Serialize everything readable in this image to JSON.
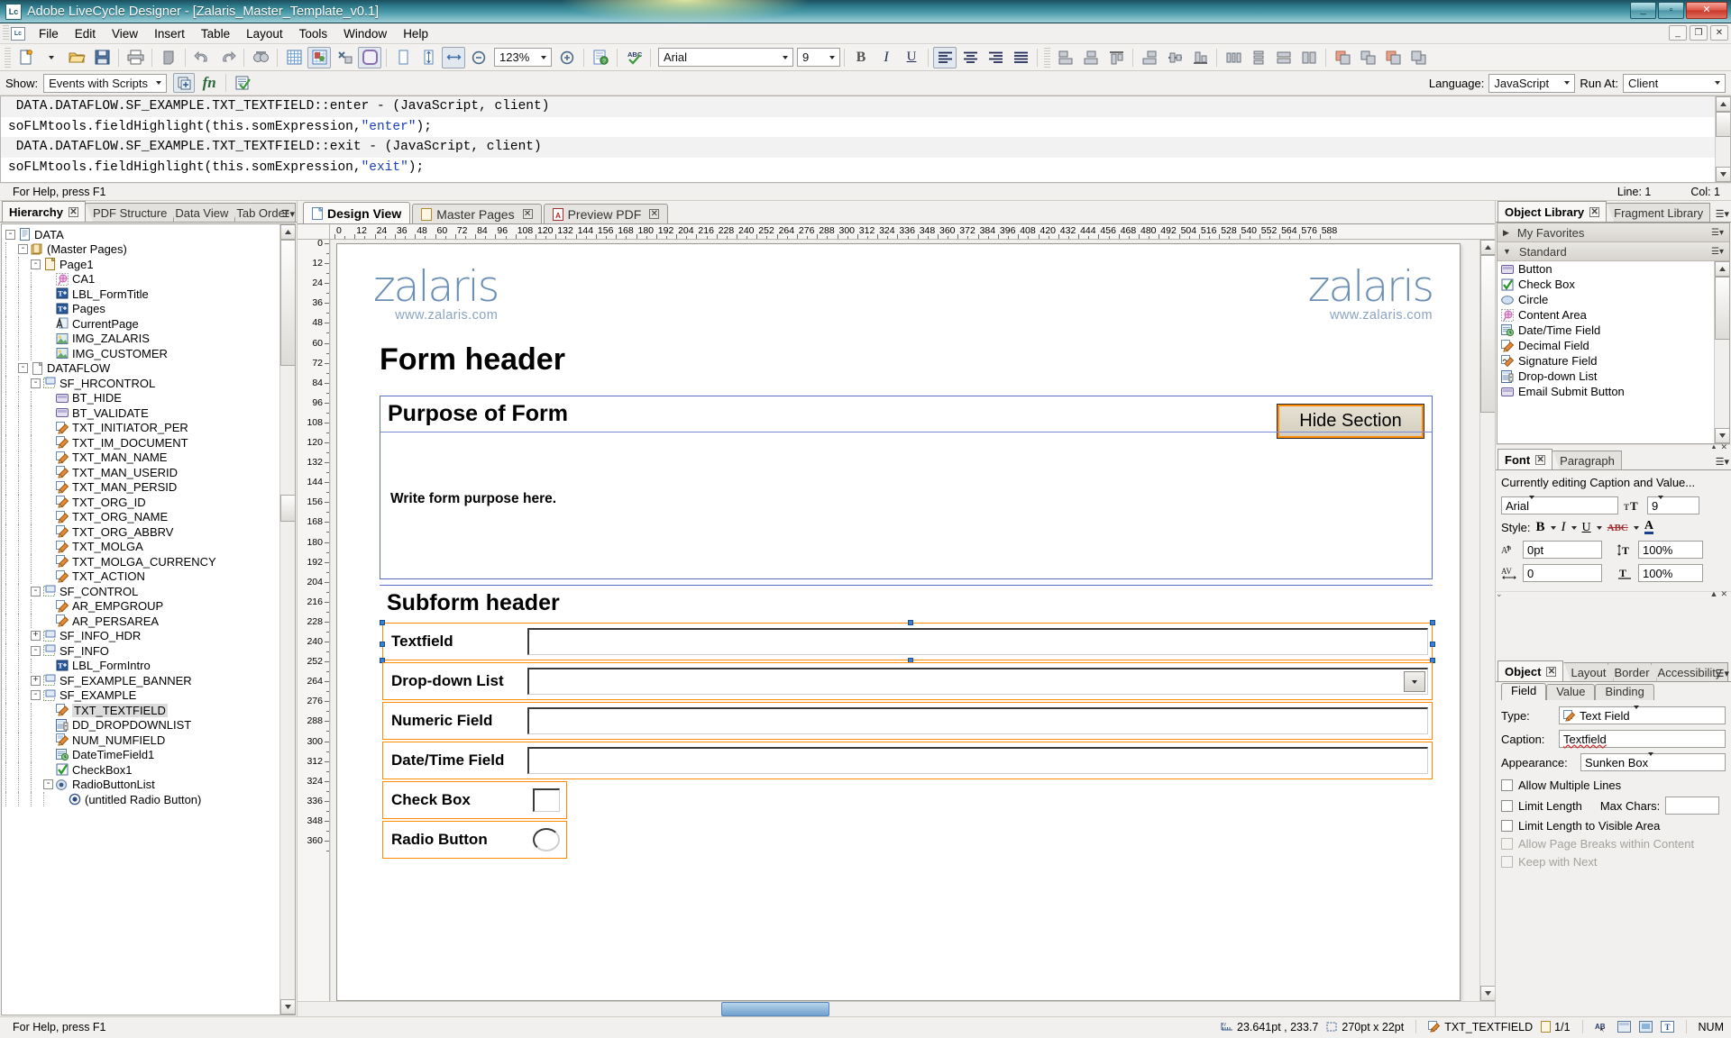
{
  "window": {
    "title": "Adobe LiveCycle Designer - [Zalaris_Master_Template_v0.1]",
    "app_icon": "Lc",
    "minimize": "_",
    "maximize": "▫",
    "close": "✕",
    "doc_minimize": "_",
    "doc_restore": "❐",
    "doc_close": "✕"
  },
  "menubar": {
    "items": [
      "File",
      "Edit",
      "View",
      "Insert",
      "Table",
      "Layout",
      "Tools",
      "Window",
      "Help"
    ]
  },
  "toolbar": {
    "zoom_value": "123%",
    "font_name": "Arial",
    "font_size": "9",
    "icons": [
      "new-document-icon",
      "open-folder-icon",
      "save-icon",
      "print-icon",
      "print-preview-icon",
      "undo-icon",
      "redo-icon",
      "find-icon",
      "grid-icon",
      "snap-to-grid-icon",
      "tab-order-icon",
      "content-area-icon",
      "page-width-icon",
      "page-height-icon",
      "fit-page-icon",
      "zoom-out-icon",
      "zoom-in-icon",
      "form-properties-icon",
      "spell-check-icon",
      "bold-icon",
      "italic-icon",
      "underline-icon",
      "align-left-icon",
      "align-center-icon",
      "align-right-icon",
      "align-justify-icon",
      "align-obj-left-icon",
      "align-obj-center-icon",
      "align-obj-right-icon",
      "align-obj-top-icon",
      "align-obj-middle-icon",
      "align-obj-bottom-icon",
      "distribute-h-icon",
      "distribute-v-icon",
      "same-width-icon",
      "same-height-icon",
      "group-icon",
      "ungroup-icon",
      "bring-front-icon",
      "send-back-icon"
    ]
  },
  "script_editor": {
    "show_label": "Show:",
    "show_value": "Events with Scripts",
    "language_label": "Language:",
    "language_value": "JavaScript",
    "runat_label": "Run At:",
    "runat_value": "Client",
    "lines": [
      {
        "type": "header",
        "text": " DATA.DATAFLOW.SF_EXAMPLE.TXT_TEXTFIELD::enter - (JavaScript, client)"
      },
      {
        "type": "code",
        "text": "soFLMtools.fieldHighlight(this.somExpression,",
        "str": "\"enter\"",
        "tail": ");"
      },
      {
        "type": "header",
        "text": " DATA.DATAFLOW.SF_EXAMPLE.TXT_TEXTFIELD::exit - (JavaScript, client)"
      },
      {
        "type": "code",
        "text": "soFLMtools.fieldHighlight(this.somExpression,",
        "str": "\"exit\"",
        "tail": ");"
      }
    ],
    "help_text": "For Help, press F1",
    "line_indicator": "Line: 1",
    "col_indicator": "Col: 1"
  },
  "left_panel": {
    "tabs": [
      {
        "label": "Hierarchy",
        "active": true,
        "closable": true
      },
      {
        "label": "PDF Structure",
        "active": false,
        "closable": false
      },
      {
        "label": "Data View",
        "active": false,
        "closable": false
      },
      {
        "label": "Tab Order",
        "active": false,
        "closable": false
      }
    ],
    "tree": [
      {
        "label": "DATA",
        "depth": 0,
        "icon": "document-icon",
        "expander": "-"
      },
      {
        "label": "(Master Pages)",
        "depth": 1,
        "icon": "master-pages-icon",
        "expander": "-"
      },
      {
        "label": "Page1",
        "depth": 2,
        "icon": "page-icon",
        "expander": "-"
      },
      {
        "label": "CA1",
        "depth": 3,
        "icon": "content-area-icon",
        "expander": ""
      },
      {
        "label": "LBL_FormTitle",
        "depth": 3,
        "icon": "text-icon",
        "expander": ""
      },
      {
        "label": "Pages",
        "depth": 3,
        "icon": "text-icon",
        "expander": ""
      },
      {
        "label": "CurrentPage",
        "depth": 3,
        "icon": "currentpage-icon",
        "expander": ""
      },
      {
        "label": "IMG_ZALARIS",
        "depth": 3,
        "icon": "image-icon",
        "expander": ""
      },
      {
        "label": "IMG_CUSTOMER",
        "depth": 3,
        "icon": "image-icon",
        "expander": ""
      },
      {
        "label": "DATAFLOW",
        "depth": 1,
        "icon": "blank-doc-icon",
        "expander": "-"
      },
      {
        "label": "SF_HRCONTROL",
        "depth": 2,
        "icon": "subform-icon",
        "expander": "-"
      },
      {
        "label": "BT_HIDE",
        "depth": 3,
        "icon": "button-icon",
        "expander": ""
      },
      {
        "label": "BT_VALIDATE",
        "depth": 3,
        "icon": "button-icon",
        "expander": ""
      },
      {
        "label": "TXT_INITIATOR_PER",
        "depth": 3,
        "icon": "textfield-icon",
        "expander": ""
      },
      {
        "label": "TXT_IM_DOCUMENT",
        "depth": 3,
        "icon": "textfield-icon",
        "expander": ""
      },
      {
        "label": "TXT_MAN_NAME",
        "depth": 3,
        "icon": "textfield-icon",
        "expander": ""
      },
      {
        "label": "TXT_MAN_USERID",
        "depth": 3,
        "icon": "textfield-icon",
        "expander": ""
      },
      {
        "label": "TXT_MAN_PERSID",
        "depth": 3,
        "icon": "textfield-icon",
        "expander": ""
      },
      {
        "label": "TXT_ORG_ID",
        "depth": 3,
        "icon": "textfield-icon",
        "expander": ""
      },
      {
        "label": "TXT_ORG_NAME",
        "depth": 3,
        "icon": "textfield-icon",
        "expander": ""
      },
      {
        "label": "TXT_ORG_ABBRV",
        "depth": 3,
        "icon": "textfield-icon",
        "expander": ""
      },
      {
        "label": "TXT_MOLGA",
        "depth": 3,
        "icon": "textfield-icon",
        "expander": ""
      },
      {
        "label": "TXT_MOLGA_CURRENCY",
        "depth": 3,
        "icon": "textfield-icon",
        "expander": ""
      },
      {
        "label": "TXT_ACTION",
        "depth": 3,
        "icon": "textfield-icon",
        "expander": ""
      },
      {
        "label": "SF_CONTROL",
        "depth": 2,
        "icon": "subform-icon",
        "expander": "-"
      },
      {
        "label": "AR_EMPGROUP",
        "depth": 3,
        "icon": "textfield-icon",
        "expander": ""
      },
      {
        "label": "AR_PERSAREA",
        "depth": 3,
        "icon": "textfield-icon",
        "expander": ""
      },
      {
        "label": "SF_INFO_HDR",
        "depth": 2,
        "icon": "subform-icon",
        "expander": "+"
      },
      {
        "label": "SF_INFO",
        "depth": 2,
        "icon": "subform-icon",
        "expander": "-"
      },
      {
        "label": "LBL_FormIntro",
        "depth": 3,
        "icon": "text-icon",
        "expander": ""
      },
      {
        "label": "SF_EXAMPLE_BANNER",
        "depth": 2,
        "icon": "subform-icon",
        "expander": "+"
      },
      {
        "label": "SF_EXAMPLE",
        "depth": 2,
        "icon": "subform-icon",
        "expander": "-"
      },
      {
        "label": "TXT_TEXTFIELD",
        "depth": 3,
        "icon": "textfield-icon",
        "expander": "",
        "selected": true
      },
      {
        "label": "DD_DROPDOWNLIST",
        "depth": 3,
        "icon": "dropdown-icon",
        "expander": ""
      },
      {
        "label": "NUM_NUMFIELD",
        "depth": 3,
        "icon": "numericfield-icon",
        "expander": ""
      },
      {
        "label": "DateTimeField1",
        "depth": 3,
        "icon": "datetime-icon",
        "expander": ""
      },
      {
        "label": "CheckBox1",
        "depth": 3,
        "icon": "checkbox-icon",
        "expander": ""
      },
      {
        "label": "RadioButtonList",
        "depth": 3,
        "icon": "radiolist-icon",
        "expander": "-"
      },
      {
        "label": "(untitled Radio Button)",
        "depth": 4,
        "icon": "radio-icon",
        "expander": ""
      }
    ]
  },
  "center_panel": {
    "tabs": [
      {
        "label": "Design View",
        "active": true,
        "closable": false,
        "icon": "design-view-icon"
      },
      {
        "label": "Master Pages",
        "active": false,
        "closable": true,
        "icon": "master-pages-tab-icon"
      },
      {
        "label": "Preview PDF",
        "active": false,
        "closable": true,
        "icon": "pdf-icon"
      }
    ],
    "ruler_h_ticks": [
      "0",
      "12",
      "24",
      "36",
      "48",
      "60",
      "72",
      "84",
      "96",
      "108",
      "120",
      "132",
      "144",
      "156",
      "168",
      "180",
      "192",
      "204",
      "216",
      "228",
      "240",
      "252",
      "264",
      "276",
      "288",
      "300",
      "312",
      "324",
      "336",
      "348",
      "360",
      "372",
      "384",
      "396",
      "408",
      "420",
      "432",
      "444",
      "456",
      "468",
      "480",
      "492",
      "504",
      "516",
      "528",
      "540",
      "552",
      "564",
      "576",
      "588"
    ],
    "ruler_v_ticks": [
      "0",
      "12",
      "24",
      "36",
      "48",
      "60",
      "72",
      "84",
      "96",
      "108",
      "120",
      "132",
      "144",
      "156",
      "168",
      "180",
      "192",
      "204",
      "216",
      "228",
      "240",
      "252",
      "264",
      "276",
      "288",
      "300",
      "312",
      "324",
      "336",
      "348",
      "360"
    ],
    "form": {
      "logo_left_text": "zalaris",
      "logo_left_url": "www.zalaris.com",
      "logo_right_text": "zalaris",
      "logo_right_url": "www.zalaris.com",
      "form_title": "Form header",
      "purpose_section_title": "Purpose of Form",
      "hide_button_label": "Hide Section",
      "purpose_body_text": "Write form purpose here.",
      "subform_header": "Subform header",
      "fields": [
        {
          "caption": "Textfield",
          "type": "text",
          "selected": true
        },
        {
          "caption": "Drop-down List",
          "type": "dropdown",
          "selected": false
        },
        {
          "caption": "Numeric Field",
          "type": "text",
          "selected": false
        },
        {
          "caption": "Date/Time Field",
          "type": "text",
          "selected": false
        },
        {
          "caption": "Check Box",
          "type": "checkbox",
          "selected": false
        },
        {
          "caption": "Radio Button",
          "type": "radio",
          "selected": false
        }
      ]
    }
  },
  "right_panel": {
    "library": {
      "tabs": [
        {
          "label": "Object Library",
          "active": true,
          "closable": true
        },
        {
          "label": "Fragment Library",
          "active": false,
          "closable": false
        }
      ],
      "groups": [
        {
          "label": "My Favorites",
          "expanded": false
        },
        {
          "label": "Standard",
          "expanded": true
        }
      ],
      "items": [
        {
          "label": "Button",
          "icon": "button-icon"
        },
        {
          "label": "Check Box",
          "icon": "checkbox-icon"
        },
        {
          "label": "Circle",
          "icon": "circle-icon"
        },
        {
          "label": "Content Area",
          "icon": "content-area-icon"
        },
        {
          "label": "Date/Time Field",
          "icon": "datetime-icon"
        },
        {
          "label": "Decimal Field",
          "icon": "decimalfield-icon"
        },
        {
          "label": "Signature Field",
          "icon": "signature-icon"
        },
        {
          "label": "Drop-down List",
          "icon": "dropdown-icon"
        },
        {
          "label": "Email Submit Button",
          "icon": "button-icon"
        }
      ]
    },
    "font": {
      "tabs": [
        {
          "label": "Font",
          "active": true,
          "closable": true
        },
        {
          "label": "Paragraph",
          "active": false,
          "closable": false
        }
      ],
      "editing_note": "Currently editing Caption and Value...",
      "font_family": "Arial",
      "font_size": "9",
      "style_label": "Style:",
      "baseline_shift": "0pt",
      "horizontal_scale": "100%",
      "letter_spacing": "0",
      "vertical_scale": "100%"
    },
    "object": {
      "tabs": [
        {
          "label": "Object",
          "active": true,
          "closable": true
        },
        {
          "label": "Layout",
          "active": false,
          "closable": false
        },
        {
          "label": "Border",
          "active": false,
          "closable": false
        },
        {
          "label": "Accessibility",
          "active": false,
          "closable": false
        }
      ],
      "subtabs": [
        {
          "label": "Field",
          "active": true
        },
        {
          "label": "Value",
          "active": false
        },
        {
          "label": "Binding",
          "active": false
        }
      ],
      "type_label": "Type:",
      "type_value": "Text Field",
      "caption_label": "Caption:",
      "caption_value": "Textfield",
      "appearance_label": "Appearance:",
      "appearance_value": "Sunken Box",
      "checkboxes": [
        {
          "label": "Allow Multiple Lines",
          "checked": false,
          "disabled": false
        },
        {
          "label": "Limit Length",
          "checked": false,
          "disabled": false
        },
        {
          "label": "Limit Length to Visible Area",
          "checked": false,
          "disabled": false
        },
        {
          "label": "Allow Page Breaks within Content",
          "checked": false,
          "disabled": true
        },
        {
          "label": "Keep with Next",
          "checked": false,
          "disabled": true
        }
      ],
      "maxchars_label": "Max Chars:",
      "maxchars_value": ""
    }
  },
  "statusbar": {
    "help_text": "For Help, press F1",
    "coordinates": "23.641pt , 233.7",
    "size": "270pt x 22pt",
    "object_name": "TXT_TEXTFIELD",
    "page_indicator": "1/1",
    "num_lock": "NUM"
  }
}
